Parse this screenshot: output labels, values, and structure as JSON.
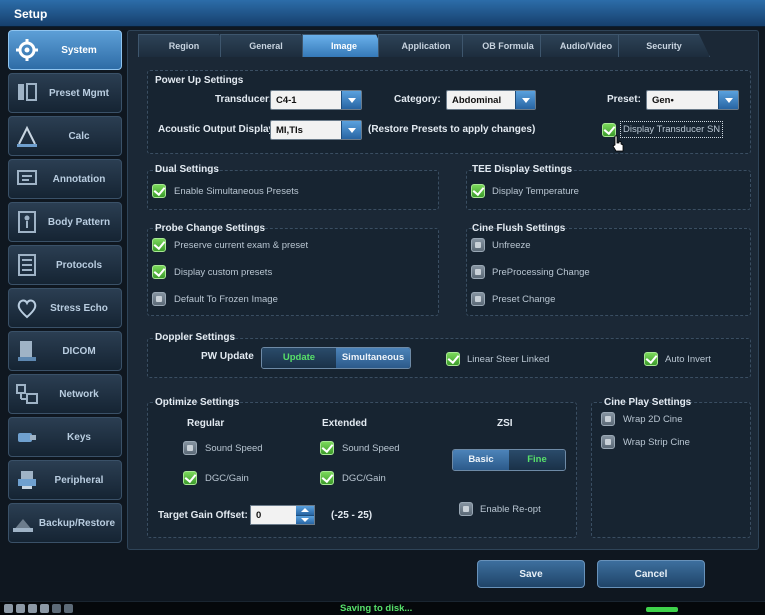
{
  "window": {
    "title": "Setup"
  },
  "sidebar": {
    "items": [
      {
        "label": "System",
        "icon": "gear-icon",
        "active": true
      },
      {
        "label": "Preset Mgmt",
        "icon": "preset-icon"
      },
      {
        "label": "Calc",
        "icon": "calc-icon"
      },
      {
        "label": "Annotation",
        "icon": "annotation-icon"
      },
      {
        "label": "Body Pattern",
        "icon": "body-pattern-icon"
      },
      {
        "label": "Protocols",
        "icon": "protocols-icon"
      },
      {
        "label": "Stress Echo",
        "icon": "heart-icon"
      },
      {
        "label": "DICOM",
        "icon": "dicom-icon"
      },
      {
        "label": "Network",
        "icon": "network-icon"
      },
      {
        "label": "Keys",
        "icon": "keys-icon"
      },
      {
        "label": "Peripheral",
        "icon": "peripheral-icon"
      },
      {
        "label": "Backup/Restore",
        "icon": "backup-icon"
      }
    ]
  },
  "tabs": [
    {
      "label": "Region"
    },
    {
      "label": "General"
    },
    {
      "label": "Image",
      "active": true
    },
    {
      "label": "Application"
    },
    {
      "label": "OB Formula"
    },
    {
      "label": "Audio/Video"
    },
    {
      "label": "Security"
    }
  ],
  "power_up": {
    "title": "Power Up Settings",
    "transducer_label": "Transducer:",
    "transducer_value": "C4-1",
    "category_label": "Category:",
    "category_value": "Abdominal",
    "preset_label": "Preset:",
    "preset_value": "Gen•",
    "aod_label": "Acoustic Output Display:",
    "aod_value": "MI,TIs",
    "restore_note": "(Restore Presets to apply changes)",
    "display_sn_label": "Display Transducer SN",
    "display_sn_checked": true
  },
  "dual": {
    "title": "Dual Settings",
    "enable_label": "Enable Simultaneous Presets",
    "enable_checked": true
  },
  "tee": {
    "title": "TEE Display Settings",
    "temp_label": "Display Temperature",
    "temp_checked": true
  },
  "probe_change": {
    "title": "Probe Change Settings",
    "items": [
      {
        "label": "Preserve current exam & preset",
        "checked": true
      },
      {
        "label": "Display custom presets",
        "checked": true
      },
      {
        "label": "Default To Frozen Image",
        "checked": false
      }
    ]
  },
  "cine_flush": {
    "title": "Cine Flush Settings",
    "items": [
      {
        "label": "Unfreeze",
        "checked": false
      },
      {
        "label": "PreProcessing Change",
        "checked": false
      },
      {
        "label": "Preset Change",
        "checked": false
      }
    ]
  },
  "doppler": {
    "title": "Doppler Settings",
    "pw_label": "PW Update",
    "seg_update": "Update",
    "seg_simultaneous": "Simultaneous",
    "selected": "Update",
    "linear_label": "Linear Steer Linked",
    "linear_checked": true,
    "auto_label": "Auto Invert",
    "auto_checked": true
  },
  "optimize": {
    "title": "Optimize Settings",
    "regular_label": "Regular",
    "extended_label": "Extended",
    "zsi_label": "ZSI",
    "reg_sound": "Sound Speed",
    "reg_sound_checked": false,
    "reg_dgc": "DGC/Gain",
    "reg_dgc_checked": true,
    "ext_sound": "Sound Speed",
    "ext_sound_checked": true,
    "ext_dgc": "DGC/Gain",
    "ext_dgc_checked": true,
    "zsi_basic": "Basic",
    "zsi_fine": "Fine",
    "zsi_selected": "Fine",
    "target_label": "Target Gain Offset:",
    "target_value": "0",
    "target_range": "(-25 - 25)",
    "reopt_label": "Enable Re-opt",
    "reopt_checked": false
  },
  "cine_play": {
    "title": "Cine Play Settings",
    "wrap2d": "Wrap 2D Cine",
    "wrap2d_checked": false,
    "wrapstrip": "Wrap Strip Cine",
    "wrapstrip_checked": false
  },
  "buttons": {
    "save": "Save",
    "cancel": "Cancel"
  },
  "status": {
    "message": "Saving to disk...",
    "progress_fraction": 0.55
  },
  "colors": {
    "accent": "#3579b8",
    "check_on": "#3c9c2b",
    "status_text": "#57e06a"
  }
}
